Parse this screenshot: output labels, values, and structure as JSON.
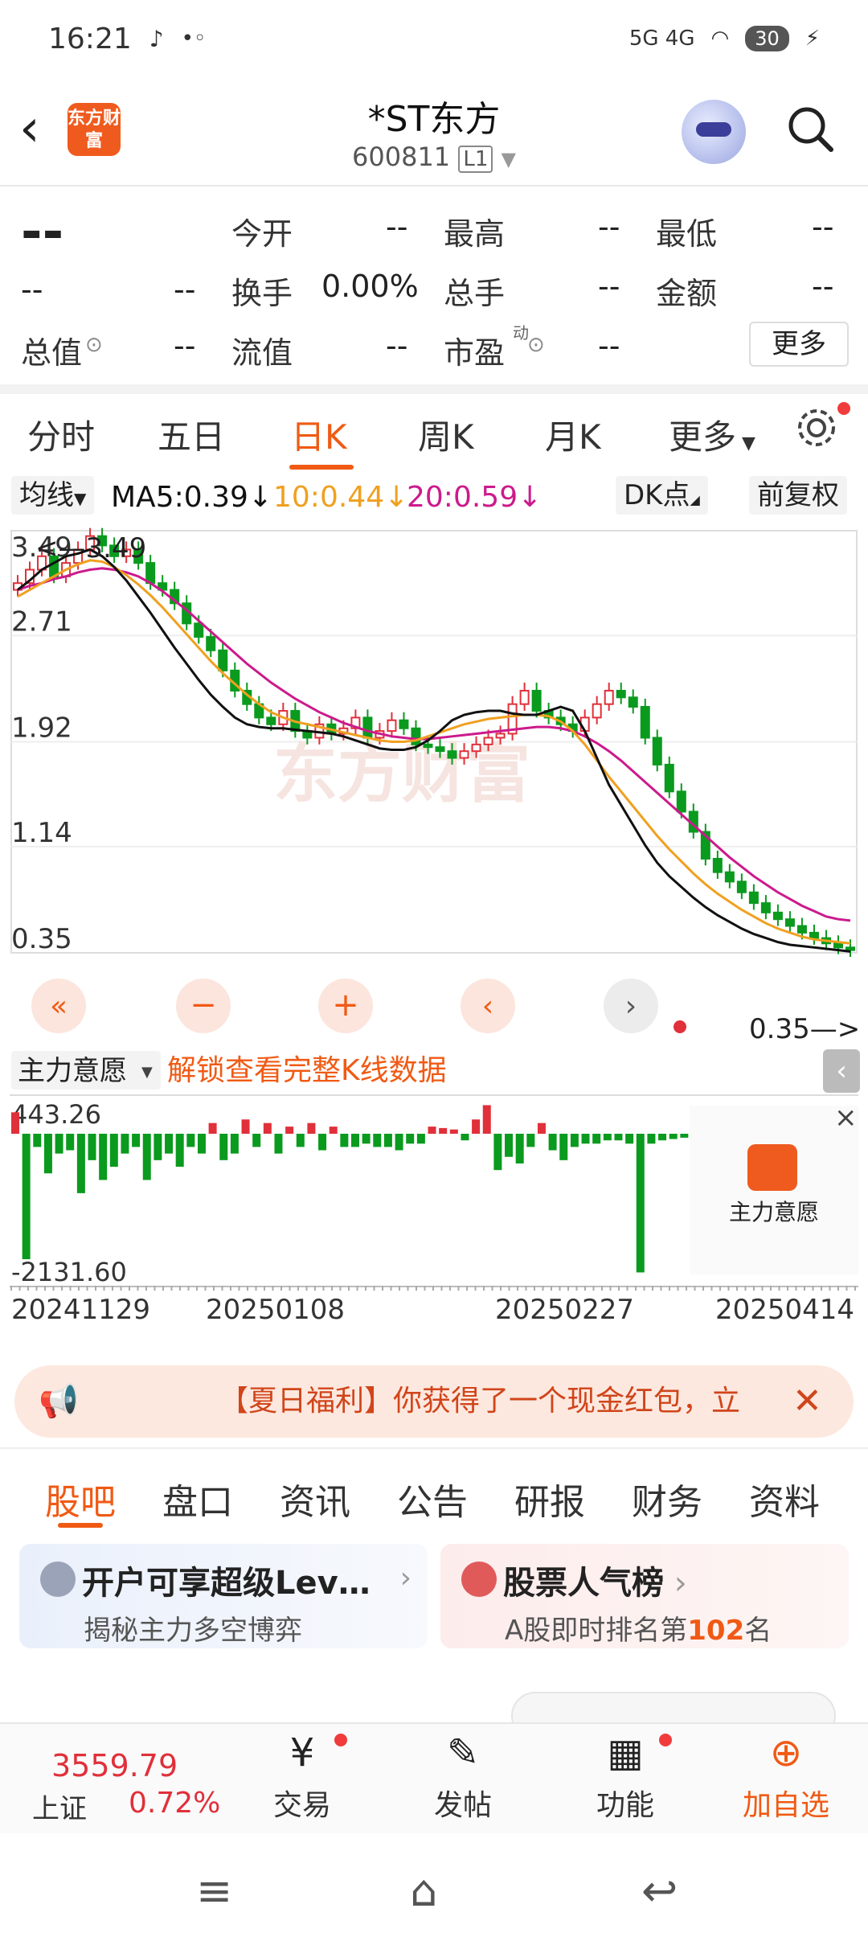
{
  "status": {
    "time": "16:21",
    "battery": "30",
    "signal": "5G 4G"
  },
  "header": {
    "logo_text": "东方财富",
    "title": "*ST东方",
    "code": "600811",
    "level": "L1"
  },
  "quote": {
    "price": "--",
    "change": "--",
    "change_pct": "--",
    "rows": [
      [
        {
          "label": "今开",
          "value": "--"
        },
        {
          "label": "最高",
          "value": "--"
        },
        {
          "label": "最低",
          "value": "--"
        }
      ],
      [
        {
          "label": "换手",
          "value": "0.00%"
        },
        {
          "label": "总手",
          "value": "--"
        },
        {
          "label": "金额",
          "value": "--"
        }
      ],
      [
        {
          "label": "流值",
          "value": "--"
        },
        {
          "label": "市盈",
          "value": "--"
        }
      ]
    ],
    "total_label": "总值",
    "total_value": "--",
    "pe_suffix": "动",
    "more": "更多"
  },
  "period_tabs": [
    "分时",
    "五日",
    "日K",
    "周K",
    "月K",
    "更多"
  ],
  "active_period": "日K",
  "ma_bar": {
    "label": "均线",
    "ma5": "MA5:0.39",
    "ma10": "10:0.44",
    "ma20": "20:0.59",
    "dk": "DK点",
    "fq": "前复权"
  },
  "colors": {
    "up": "#e0303a",
    "down": "#0a9a1e",
    "ma5": "#111111",
    "ma10": "#f0a020",
    "ma20": "#cc1a8c",
    "accent": "#f05a14"
  },
  "chart_data": {
    "type": "candlestick",
    "y_ticks": [
      "3.49",
      "2.71",
      "1.92",
      "1.14",
      "0.35"
    ],
    "ylim": [
      0.35,
      3.49
    ],
    "high_label": "3.49",
    "low_label": "0.35",
    "watermark": "东方财富",
    "close": [
      3.1,
      3.2,
      3.3,
      3.15,
      3.25,
      3.35,
      3.45,
      3.38,
      3.3,
      3.35,
      3.25,
      3.1,
      3.05,
      2.95,
      2.8,
      2.7,
      2.6,
      2.45,
      2.3,
      2.2,
      2.1,
      2.05,
      2.15,
      2.0,
      1.95,
      2.05,
      1.98,
      2.02,
      2.1,
      1.95,
      2.0,
      2.08,
      2.02,
      1.9,
      1.88,
      1.85,
      1.8,
      1.85,
      1.9,
      1.95,
      1.98,
      2.2,
      2.3,
      2.15,
      2.1,
      2.05,
      2.0,
      2.1,
      2.2,
      2.3,
      2.25,
      2.18,
      1.95,
      1.75,
      1.55,
      1.4,
      1.25,
      1.05,
      0.95,
      0.88,
      0.8,
      0.72,
      0.65,
      0.6,
      0.55,
      0.5,
      0.46,
      0.42,
      0.39,
      0.37
    ],
    "ma5": [
      3.05,
      3.12,
      3.2,
      3.25,
      3.3,
      3.32,
      3.35,
      3.3,
      3.22,
      3.12,
      3.0,
      2.88,
      2.75,
      2.62,
      2.5,
      2.38,
      2.27,
      2.18,
      2.1,
      2.05,
      2.03,
      2.02,
      2.02,
      2.01,
      2.0,
      1.99,
      1.98,
      1.96,
      1.93,
      1.9,
      1.87,
      1.86,
      1.86,
      1.88,
      1.93,
      2.0,
      2.08,
      2.12,
      2.14,
      2.15,
      2.15,
      2.13,
      2.12,
      2.12,
      2.15,
      2.18,
      2.15,
      2.0,
      1.8,
      1.6,
      1.45,
      1.3,
      1.15,
      1.02,
      0.92,
      0.84,
      0.76,
      0.69,
      0.63,
      0.58,
      0.53,
      0.49,
      0.46,
      0.43,
      0.41,
      0.4,
      0.39,
      0.38,
      0.37,
      0.36
    ],
    "ma10": [
      3.0,
      3.05,
      3.1,
      3.15,
      3.2,
      3.24,
      3.27,
      3.26,
      3.22,
      3.16,
      3.09,
      3.01,
      2.92,
      2.82,
      2.72,
      2.62,
      2.52,
      2.43,
      2.35,
      2.27,
      2.2,
      2.14,
      2.1,
      2.07,
      2.05,
      2.03,
      2.01,
      1.99,
      1.97,
      1.95,
      1.93,
      1.92,
      1.92,
      1.93,
      1.96,
      1.99,
      2.02,
      2.05,
      2.07,
      2.09,
      2.1,
      2.11,
      2.12,
      2.12,
      2.11,
      2.07,
      2.0,
      1.9,
      1.78,
      1.66,
      1.55,
      1.44,
      1.33,
      1.22,
      1.12,
      1.03,
      0.94,
      0.86,
      0.79,
      0.73,
      0.67,
      0.62,
      0.57,
      0.53,
      0.5,
      0.47,
      0.45,
      0.44,
      0.43,
      0.42
    ],
    "ma20": [
      3.05,
      3.08,
      3.1,
      3.13,
      3.15,
      3.18,
      3.2,
      3.21,
      3.2,
      3.18,
      3.15,
      3.1,
      3.04,
      2.97,
      2.9,
      2.82,
      2.74,
      2.66,
      2.58,
      2.5,
      2.43,
      2.36,
      2.3,
      2.24,
      2.19,
      2.14,
      2.1,
      2.06,
      2.03,
      2.0,
      1.98,
      1.96,
      1.95,
      1.94,
      1.94,
      1.95,
      1.96,
      1.97,
      1.98,
      1.99,
      2.0,
      2.01,
      2.02,
      2.03,
      2.03,
      2.02,
      2.0,
      1.96,
      1.91,
      1.85,
      1.78,
      1.7,
      1.62,
      1.54,
      1.46,
      1.38,
      1.3,
      1.22,
      1.14,
      1.06,
      0.99,
      0.92,
      0.86,
      0.8,
      0.75,
      0.7,
      0.66,
      0.62,
      0.6,
      0.59
    ]
  },
  "volume": {
    "label": "主力意愿",
    "unlock": "解锁查看完整K线数据",
    "max": "443.26",
    "min": "-2131.60",
    "values": [
      300,
      -1900,
      -200,
      -600,
      -300,
      -250,
      -900,
      -400,
      -700,
      -500,
      -300,
      -200,
      -700,
      -400,
      -300,
      -500,
      -200,
      -300,
      150,
      -400,
      -300,
      200,
      -200,
      150,
      -300,
      100,
      -200,
      150,
      -250,
      100,
      -200,
      -200,
      -150,
      -200,
      -200,
      -250,
      -150,
      -150,
      100,
      80,
      60,
      -100,
      200,
      400,
      -550,
      -350,
      -450,
      -200,
      150,
      -250,
      -400,
      -200,
      -150,
      -150,
      -100,
      -100,
      -150,
      -2100,
      -150,
      -100,
      -80,
      -60
    ],
    "side_label": "主力意愿",
    "dates": [
      "20241129",
      "20250108",
      "20250227",
      "20250414"
    ]
  },
  "promo": "【夏日福利】你获得了一个现金红包，立",
  "section_tabs": [
    "股吧",
    "盘口",
    "资讯",
    "公告",
    "研报",
    "财务",
    "资料"
  ],
  "cards": [
    {
      "title": "开户可享超级Lev…",
      "sub": "揭秘主力多空博弈"
    },
    {
      "title": "股票人气榜",
      "sub_pre": "A股即时排名第",
      "sub_num": "102",
      "sub_post": "名"
    }
  ],
  "bottom": {
    "index_value": "3559.79",
    "index_name": "上证",
    "index_change": "0.72%",
    "items": [
      "交易",
      "发帖",
      "功能",
      "加自选"
    ]
  }
}
